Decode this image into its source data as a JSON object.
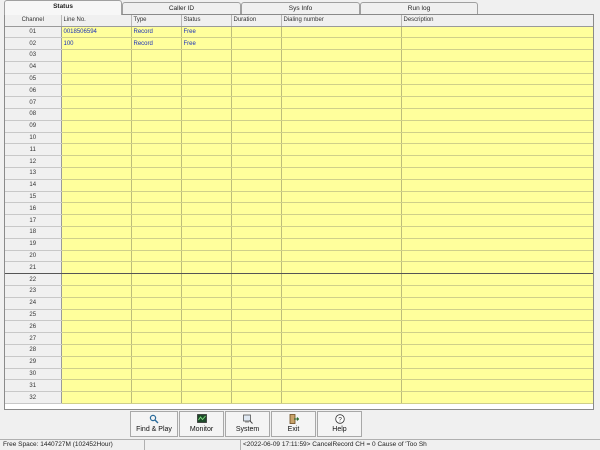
{
  "tabs": [
    {
      "label": "Status"
    },
    {
      "label": "Caller ID"
    },
    {
      "label": "Sys Info"
    },
    {
      "label": "Run log"
    }
  ],
  "table": {
    "columns": [
      "Channel",
      "Line No.",
      "Type",
      "Status",
      "Duration",
      "Dialing number",
      "Description"
    ],
    "rows": [
      {
        "channel": "01",
        "line": "0018506594",
        "type": "Record",
        "status": "Free",
        "duration": "",
        "dialing": "",
        "description": ""
      },
      {
        "channel": "02",
        "line": "100",
        "type": "Record",
        "status": "Free",
        "duration": "",
        "dialing": "",
        "description": ""
      },
      {
        "channel": "03",
        "line": "",
        "type": "",
        "status": "",
        "duration": "",
        "dialing": "",
        "description": ""
      },
      {
        "channel": "04",
        "line": "",
        "type": "",
        "status": "",
        "duration": "",
        "dialing": "",
        "description": ""
      },
      {
        "channel": "05",
        "line": "",
        "type": "",
        "status": "",
        "duration": "",
        "dialing": "",
        "description": ""
      },
      {
        "channel": "06",
        "line": "",
        "type": "",
        "status": "",
        "duration": "",
        "dialing": "",
        "description": ""
      },
      {
        "channel": "07",
        "line": "",
        "type": "",
        "status": "",
        "duration": "",
        "dialing": "",
        "description": ""
      },
      {
        "channel": "08",
        "line": "",
        "type": "",
        "status": "",
        "duration": "",
        "dialing": "",
        "description": ""
      },
      {
        "channel": "09",
        "line": "",
        "type": "",
        "status": "",
        "duration": "",
        "dialing": "",
        "description": ""
      },
      {
        "channel": "10",
        "line": "",
        "type": "",
        "status": "",
        "duration": "",
        "dialing": "",
        "description": ""
      },
      {
        "channel": "11",
        "line": "",
        "type": "",
        "status": "",
        "duration": "",
        "dialing": "",
        "description": ""
      },
      {
        "channel": "12",
        "line": "",
        "type": "",
        "status": "",
        "duration": "",
        "dialing": "",
        "description": ""
      },
      {
        "channel": "13",
        "line": "",
        "type": "",
        "status": "",
        "duration": "",
        "dialing": "",
        "description": ""
      },
      {
        "channel": "14",
        "line": "",
        "type": "",
        "status": "",
        "duration": "",
        "dialing": "",
        "description": ""
      },
      {
        "channel": "15",
        "line": "",
        "type": "",
        "status": "",
        "duration": "",
        "dialing": "",
        "description": ""
      },
      {
        "channel": "16",
        "line": "",
        "type": "",
        "status": "",
        "duration": "",
        "dialing": "",
        "description": ""
      },
      {
        "channel": "17",
        "line": "",
        "type": "",
        "status": "",
        "duration": "",
        "dialing": "",
        "description": ""
      },
      {
        "channel": "18",
        "line": "",
        "type": "",
        "status": "",
        "duration": "",
        "dialing": "",
        "description": ""
      },
      {
        "channel": "19",
        "line": "",
        "type": "",
        "status": "",
        "duration": "",
        "dialing": "",
        "description": ""
      },
      {
        "channel": "20",
        "line": "",
        "type": "",
        "status": "",
        "duration": "",
        "dialing": "",
        "description": ""
      },
      {
        "channel": "21",
        "line": "",
        "type": "",
        "status": "",
        "duration": "",
        "dialing": "",
        "description": ""
      },
      {
        "channel": "22",
        "line": "",
        "type": "",
        "status": "",
        "duration": "",
        "dialing": "",
        "description": ""
      },
      {
        "channel": "23",
        "line": "",
        "type": "",
        "status": "",
        "duration": "",
        "dialing": "",
        "description": ""
      },
      {
        "channel": "24",
        "line": "",
        "type": "",
        "status": "",
        "duration": "",
        "dialing": "",
        "description": ""
      },
      {
        "channel": "25",
        "line": "",
        "type": "",
        "status": "",
        "duration": "",
        "dialing": "",
        "description": ""
      },
      {
        "channel": "26",
        "line": "",
        "type": "",
        "status": "",
        "duration": "",
        "dialing": "",
        "description": ""
      },
      {
        "channel": "27",
        "line": "",
        "type": "",
        "status": "",
        "duration": "",
        "dialing": "",
        "description": ""
      },
      {
        "channel": "28",
        "line": "",
        "type": "",
        "status": "",
        "duration": "",
        "dialing": "",
        "description": ""
      },
      {
        "channel": "29",
        "line": "",
        "type": "",
        "status": "",
        "duration": "",
        "dialing": "",
        "description": ""
      },
      {
        "channel": "30",
        "line": "",
        "type": "",
        "status": "",
        "duration": "",
        "dialing": "",
        "description": ""
      },
      {
        "channel": "31",
        "line": "",
        "type": "",
        "status": "",
        "duration": "",
        "dialing": "",
        "description": ""
      },
      {
        "channel": "32",
        "line": "",
        "type": "",
        "status": "",
        "duration": "",
        "dialing": "",
        "description": ""
      }
    ]
  },
  "toolbar": {
    "buttons": [
      {
        "label": "Find & Play",
        "icon": "find-play-icon"
      },
      {
        "label": "Monitor",
        "icon": "monitor-icon"
      },
      {
        "label": "System",
        "icon": "system-icon"
      },
      {
        "label": "Exit",
        "icon": "exit-icon"
      },
      {
        "label": "Help",
        "icon": "help-icon"
      }
    ]
  },
  "statusbar": {
    "free_space": "Free Space: 1440727M (102452Hour)",
    "log": "<2022-06-09 17:11:59>  CancelRecord CH = 0 Cause of 'Too Sh"
  },
  "colors": {
    "row_bg": "#ffff9c",
    "cell_text": "#1a30b8",
    "chrome_bg": "#f0f0f0"
  }
}
